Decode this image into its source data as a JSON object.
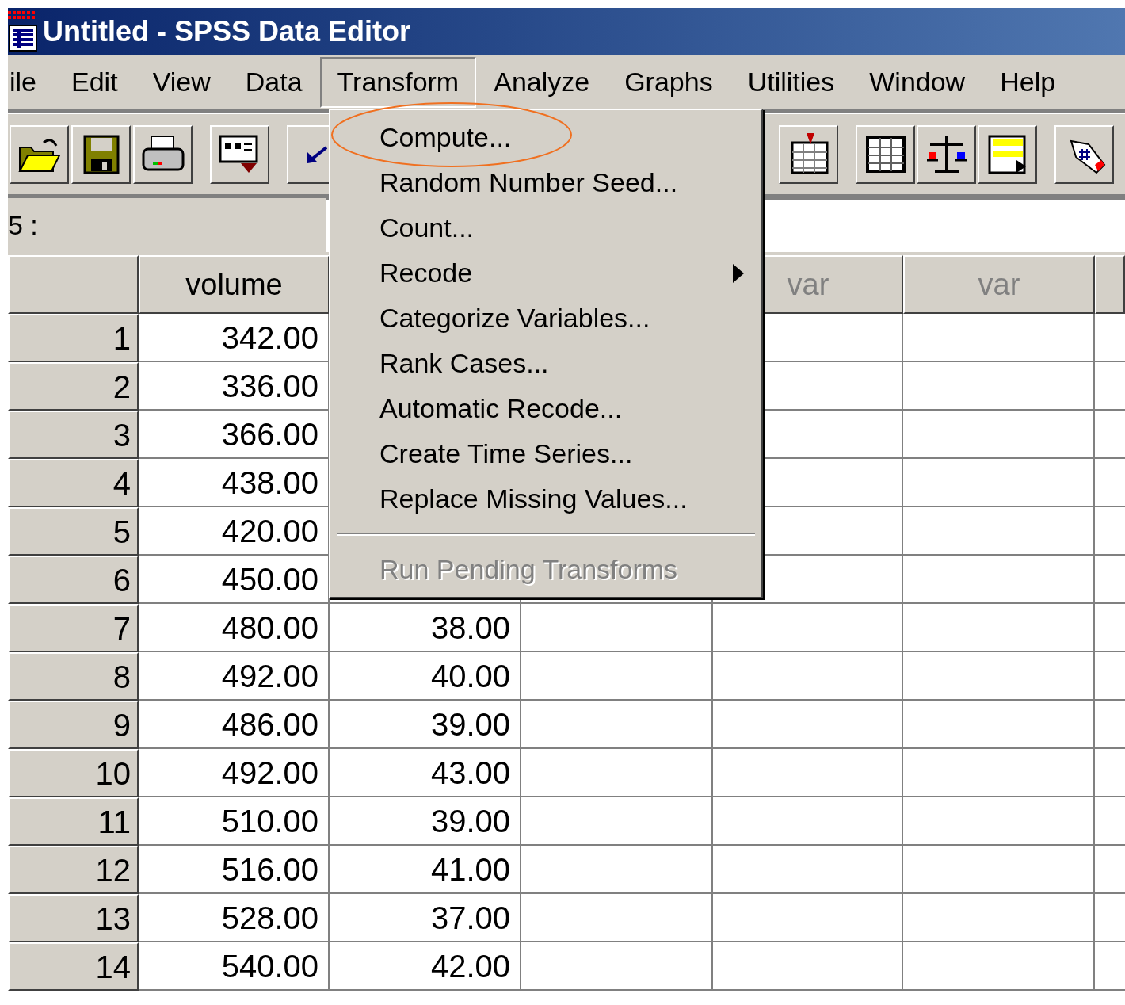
{
  "window": {
    "title": "Untitled - SPSS Data Editor"
  },
  "menu_bar": [
    {
      "label": "ile",
      "selected": false
    },
    {
      "label": "Edit",
      "selected": false
    },
    {
      "label": "View",
      "selected": false
    },
    {
      "label": "Data",
      "selected": false
    },
    {
      "label": "Transform",
      "selected": true
    },
    {
      "label": "Analyze",
      "selected": false
    },
    {
      "label": "Graphs",
      "selected": false
    },
    {
      "label": "Utilities",
      "selected": false
    },
    {
      "label": "Window",
      "selected": false
    },
    {
      "label": "Help",
      "selected": false
    }
  ],
  "cell_reference": "5 :",
  "column_headers": {
    "column_1": "volume",
    "column_4": "var",
    "column_5": "var"
  },
  "rows": [
    {
      "case": "1",
      "volume": "342.00"
    },
    {
      "case": "2",
      "volume": "336.00"
    },
    {
      "case": "3",
      "volume": "366.00"
    },
    {
      "case": "4",
      "volume": "438.00"
    },
    {
      "case": "5",
      "volume": "420.00"
    },
    {
      "case": "6",
      "volume": "450.00"
    },
    {
      "case": "7",
      "volume": "480.00",
      "column_2": "38.00"
    },
    {
      "case": "8",
      "volume": "492.00",
      "column_2": "40.00"
    },
    {
      "case": "9",
      "volume": "486.00",
      "column_2": "39.00"
    },
    {
      "case": "10",
      "volume": "492.00",
      "column_2": "43.00"
    },
    {
      "case": "11",
      "volume": "510.00",
      "column_2": "39.00"
    },
    {
      "case": "12",
      "volume": "516.00",
      "column_2": "41.00"
    },
    {
      "case": "13",
      "volume": "528.00",
      "column_2": "37.00"
    },
    {
      "case": "14",
      "volume": "540.00",
      "column_2": "42.00"
    }
  ],
  "transform_menu": [
    {
      "kind": "command",
      "label": "Compute...",
      "submenu": false,
      "disabled": false
    },
    {
      "kind": "command",
      "label": "Random Number Seed...",
      "submenu": false,
      "disabled": false
    },
    {
      "kind": "command",
      "label": "Count...",
      "submenu": false,
      "disabled": false
    },
    {
      "kind": "command",
      "label": "Recode",
      "submenu": true,
      "disabled": false
    },
    {
      "kind": "command",
      "label": "Categorize Variables...",
      "submenu": false,
      "disabled": false
    },
    {
      "kind": "command",
      "label": "Rank Cases...",
      "submenu": false,
      "disabled": false
    },
    {
      "kind": "command",
      "label": "Automatic Recode...",
      "submenu": false,
      "disabled": false
    },
    {
      "kind": "command",
      "label": "Create Time Series...",
      "submenu": false,
      "disabled": false
    },
    {
      "kind": "command",
      "label": "Replace Missing Values...",
      "submenu": false,
      "disabled": false
    },
    {
      "kind": "separator"
    },
    {
      "kind": "command",
      "label": "Run Pending Transforms",
      "submenu": false,
      "disabled": true
    }
  ]
}
